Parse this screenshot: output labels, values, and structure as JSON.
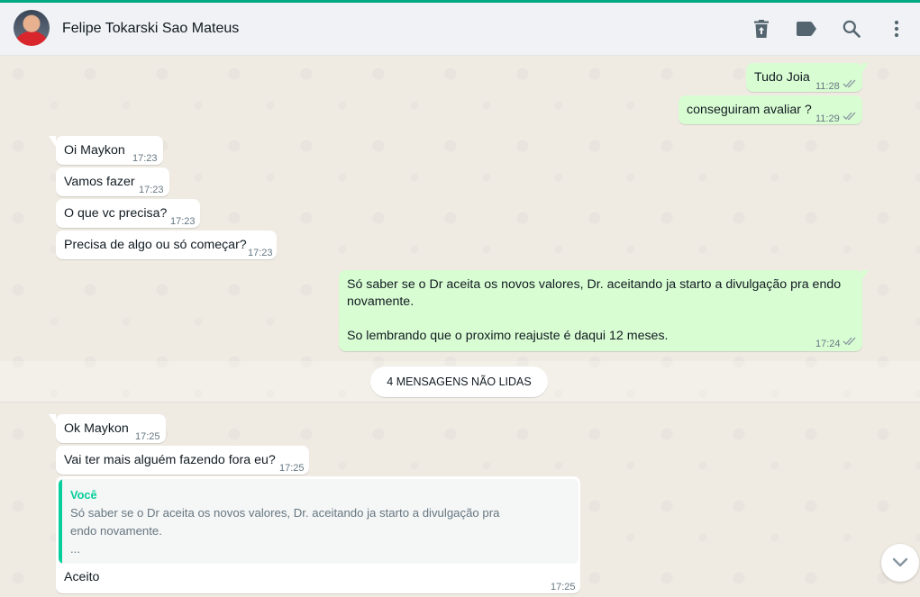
{
  "header": {
    "contact_name": "Felipe Tokarski Sao Mateus",
    "icons": [
      "delete-icon",
      "label-icon",
      "search-icon",
      "menu-icon"
    ]
  },
  "colors": {
    "accent": "#00a884",
    "incoming_bubble": "#ffffff",
    "outgoing_bubble": "#d9fdd3",
    "quote_author": "#06cf9c",
    "chat_background": "#efeae2"
  },
  "messages": {
    "m1": {
      "text": "Tudo Joia",
      "time": "11:28"
    },
    "m2": {
      "text": "conseguiram avaliar ?",
      "time": "11:29"
    },
    "m3": {
      "text": "Oi Maykon",
      "time": "17:23"
    },
    "m4": {
      "text": "Vamos fazer",
      "time": "17:23"
    },
    "m5": {
      "text": "O que vc precisa?",
      "time": "17:23"
    },
    "m6": {
      "text": "Precisa de algo ou só começar?",
      "time": "17:23"
    },
    "m7": {
      "line1": "Só saber se o Dr aceita os novos valores, Dr. aceitando ja starto a divulgação pra endo",
      "line2": "novamente.",
      "line3": "So lembrando que o proximo reajuste é daqui 12 meses.",
      "time": "17:24"
    },
    "m8": {
      "text": "Ok Maykon",
      "time": "17:25"
    },
    "m9": {
      "text": "Vai ter mais alguém fazendo fora eu?",
      "time": "17:25"
    },
    "m10": {
      "quote_author": "Você",
      "quote_line1": "Só saber se o Dr aceita os novos valores, Dr. aceitando ja starto a divulgação pra",
      "quote_line2": "endo novamente.",
      "quote_line3": "...",
      "text": "Aceito",
      "time": "17:25"
    }
  },
  "unread_label": "4 MENSAGENS NÃO LIDAS"
}
